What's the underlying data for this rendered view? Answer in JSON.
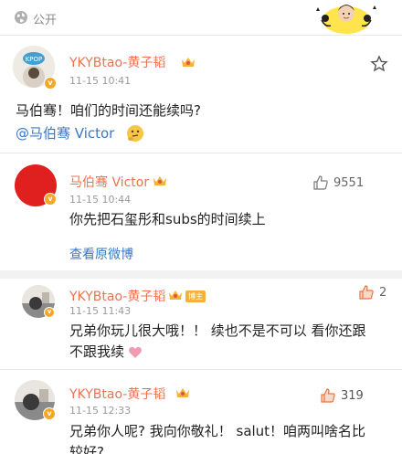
{
  "header": {
    "visibility": "公开",
    "globe_icon": "globe-icon",
    "sticker": "cartoon-sticker"
  },
  "post": {
    "author": "YKYBtao-黄子韬",
    "time": "11-15 10:41",
    "line1": "马伯骞！咱们的时间还能续吗?",
    "mention": "@马伯骞 Victor",
    "emoji": "thinking-emoji"
  },
  "comments": [
    {
      "author": "马伯骞 Victor",
      "time": "11-15 10:44",
      "text": "你先把石玺彤和subs的时间续上",
      "likes": "9551",
      "view_original": "查看原微博"
    },
    {
      "author": "YKYBtao-黄子韬",
      "tag": "博主",
      "time": "11-15 11:43",
      "line1": "兄弟你玩儿很大哦！！ 续也不是不可以 看你还跟",
      "line2": "不跟我续",
      "likes": "2"
    },
    {
      "author": "YKYBtao-黄子韬",
      "time": "11-15 12:33",
      "line1": "兄弟你人呢? 我向你敬礼！ salut！咱两叫啥名比",
      "line2": "较好?",
      "likes": "319"
    }
  ],
  "colors": {
    "name": "#eb7350",
    "link": "#3a78c4",
    "badge": "#f5a623",
    "like_hot": "#f0743c"
  }
}
